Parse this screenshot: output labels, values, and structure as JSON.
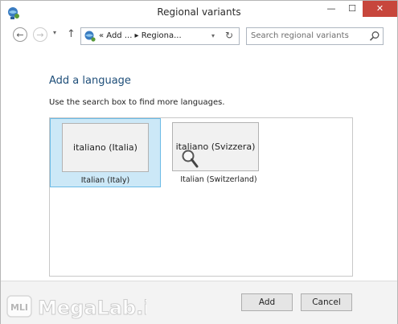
{
  "window": {
    "title": "Regional variants"
  },
  "title_buttons": {
    "minimize": "—",
    "maximize": "☐",
    "close": "✕"
  },
  "nav": {
    "back": "←",
    "forward": "→",
    "dropdown": "▾",
    "up": "↑",
    "address_text": "« Add ...  ▸ Regiona...",
    "address_dropdown": "▾",
    "refresh": "↻",
    "search_placeholder": "Search regional variants"
  },
  "content": {
    "heading": "Add a language",
    "instruction": "Use the search box to find more languages.",
    "languages": [
      {
        "tile_label": "italiano (Italia)",
        "caption": "Italian (Italy)",
        "selected": true
      },
      {
        "tile_label": "italiano (Svizzera)",
        "caption": "Italian (Switzerland)",
        "selected": false
      }
    ]
  },
  "footer": {
    "add_label": "Add",
    "cancel_label": "Cancel"
  },
  "watermark": {
    "text": "MegaLab.it",
    "badge": "MLI"
  },
  "colors": {
    "heading": "#1e4e79",
    "selection_bg": "#cce8f7",
    "selection_border": "#6bbbe6",
    "close_button": "#c7463c"
  }
}
